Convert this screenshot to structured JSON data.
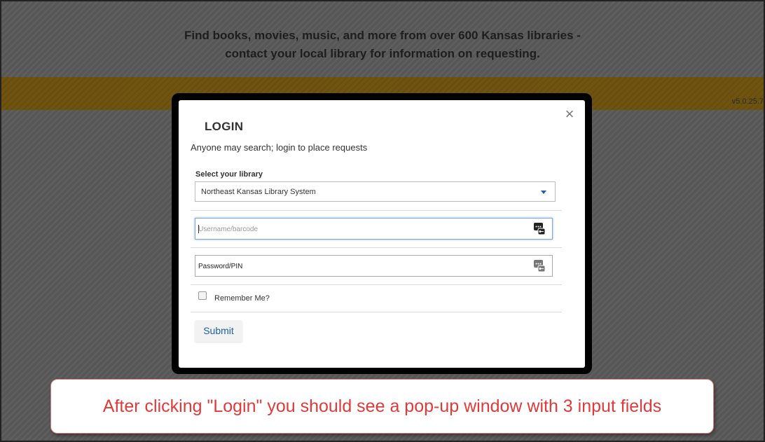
{
  "header": {
    "tagline_line1": "Find books, movies, music, and more from over 600 Kansas libraries -",
    "tagline_line2": "contact your local library for information on requesting.",
    "version": "v5.0.25.7"
  },
  "login_modal": {
    "close_glyph": "×",
    "title": "LOGIN",
    "subtitle": "Anyone may search; login to place requests",
    "library_label": "Select your library",
    "library_selected": "Northeast Kansas Library System",
    "username_placeholder": "Username/barcode",
    "password_placeholder": "Password/PIN",
    "remember_label": "Remember Me?",
    "remember_checked": false,
    "submit_label": "Submit"
  },
  "callout": {
    "text": "After clicking \"Login\" you should see a pop-up window with 3 input fields"
  },
  "colors": {
    "accent_blue": "#1a5fa8",
    "callout_red": "#e03a3a",
    "header_bar": "#6f5410"
  }
}
